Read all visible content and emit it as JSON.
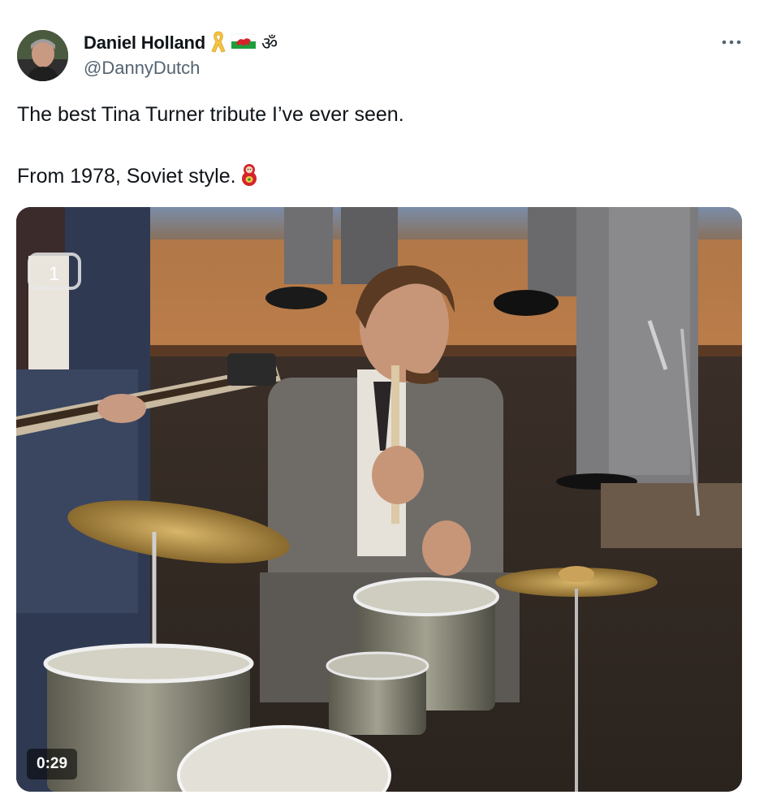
{
  "author": {
    "display_name": "Daniel Holland",
    "handle": "@DannyDutch",
    "badges": [
      "yellow-ribbon-icon",
      "welsh-flag-icon",
      "om-symbol-icon"
    ],
    "om_glyph": "ॐ"
  },
  "tweet": {
    "text_line1": "The best Tina Turner tribute I’ve ever seen.",
    "text_line2": "From 1978, Soviet style."
  },
  "video": {
    "duration": "0:29",
    "channel_logo": "1"
  },
  "colors": {
    "handle": "#536471",
    "text": "#0f1419",
    "ribbon": "#f5c342",
    "flag_green": "#1f9e3c",
    "flag_red": "#d3242c"
  }
}
